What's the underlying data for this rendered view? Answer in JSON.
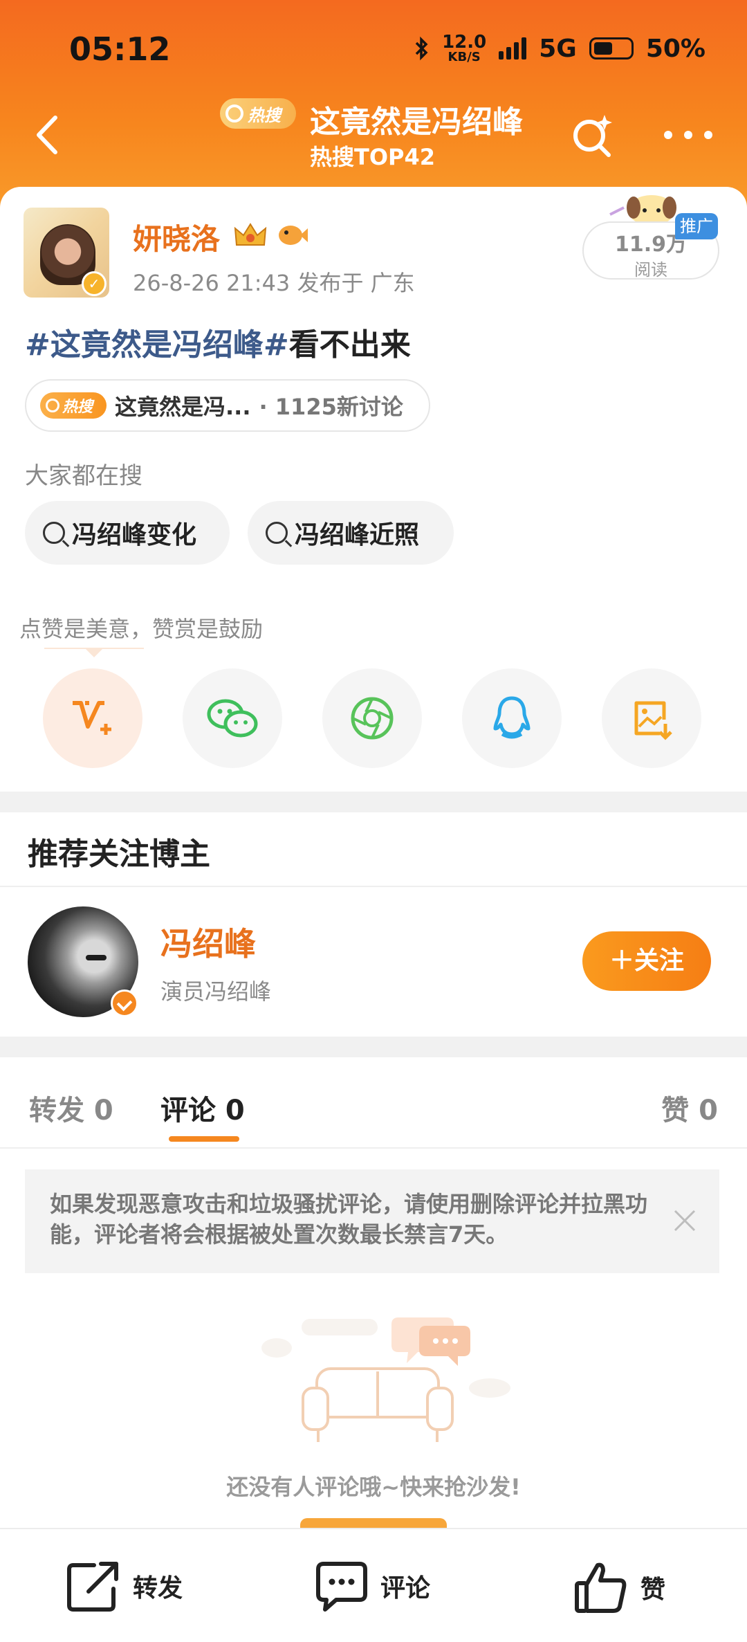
{
  "status_bar": {
    "time": "05:12",
    "net_speed_value": "12.0",
    "net_speed_unit": "KB/S",
    "network": "5G",
    "battery": "50%"
  },
  "nav": {
    "hot_badge": "热搜",
    "title": "这竟然是冯绍峰",
    "subtitle": "热搜TOP42"
  },
  "post": {
    "author": "妍晓洛",
    "meta": "26-8-26 21:43  发布于 广东",
    "read_count": "11.9万",
    "read_label": "阅读",
    "promo_badge": "推广",
    "hashtag": "#这竟然是冯绍峰#",
    "text_rest": "看不出来",
    "topic_badge": "热搜",
    "topic_title": "这竟然是冯...",
    "topic_count": "· 1125新讨论"
  },
  "search": {
    "label": "大家都在搜",
    "chips": [
      "冯绍峰变化",
      "冯绍峰近照"
    ]
  },
  "share": {
    "tip": "点赞是美意，赞赏是鼓励",
    "icons": [
      "weibo-v-plus-icon",
      "wechat-icon",
      "moments-icon",
      "qq-icon",
      "save-image-icon"
    ]
  },
  "recommend": {
    "title": "推荐关注博主",
    "name": "冯绍峰",
    "desc": "演员冯绍峰",
    "follow_label": "＋关注"
  },
  "tabs": {
    "repost": "转发 0",
    "comment": "评论 0",
    "like": "赞 0"
  },
  "notice": {
    "text": "如果发现恶意攻击和垃圾骚扰评论，请使用删除评论并拉黑功能，评论者将会根据被处置次数最长禁言7天。"
  },
  "empty": {
    "text": "还没有人评论哦~快来抢沙发!"
  },
  "bottom_bar": {
    "repost": "转发",
    "comment": "评论",
    "like": "赞"
  },
  "colors": {
    "header_orange": "#f46a1f",
    "accent_orange": "#e8711d",
    "hashtag_blue": "#3d5a8a",
    "promo_blue": "#3d8fe0"
  }
}
